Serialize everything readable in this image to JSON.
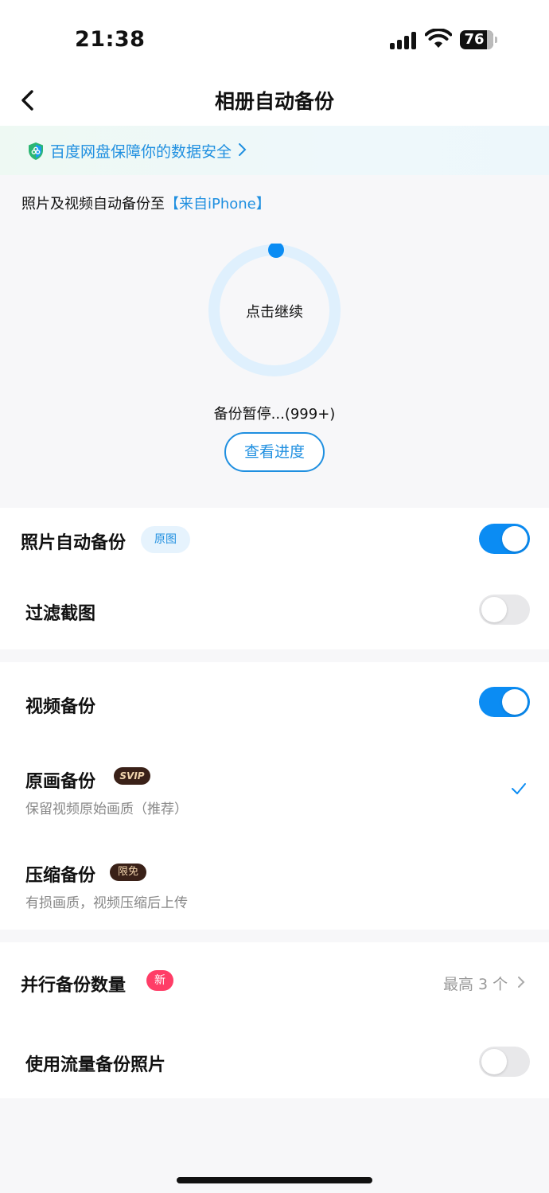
{
  "status": {
    "time": "21:38",
    "battery": "76"
  },
  "nav": {
    "title": "相册自动备份"
  },
  "banner": {
    "text": "百度网盘保障你的数据安全"
  },
  "hero": {
    "dest_prefix": "照片及视频自动备份至",
    "dest_link": "【来自iPhone】",
    "ring_label": "点击继续",
    "status": "备份暂停...(999+)",
    "button": "查看进度"
  },
  "photo": {
    "label": "照片自动备份",
    "tag": "原图",
    "toggle_on": true,
    "filter_label": "过滤截图",
    "filter_on": false
  },
  "video": {
    "label": "视频备份",
    "toggle_on": true,
    "original": {
      "label": "原画备份",
      "tag": "SVIP",
      "sub": "保留视频原始画质（推荐）",
      "selected": true
    },
    "compressed": {
      "label": "压缩备份",
      "tag": "限免",
      "sub": "有损画质，视频压缩后上传"
    }
  },
  "parallel": {
    "label": "并行备份数量",
    "tag": "新",
    "value": "最高 3 个"
  },
  "cellular": {
    "label": "使用流量备份照片",
    "toggle_on": false
  },
  "colors": {
    "accent": "#0b8cf3",
    "link": "#1f8fe0",
    "new_badge": "#ff3d67",
    "svip_bg": "#3a2118"
  }
}
